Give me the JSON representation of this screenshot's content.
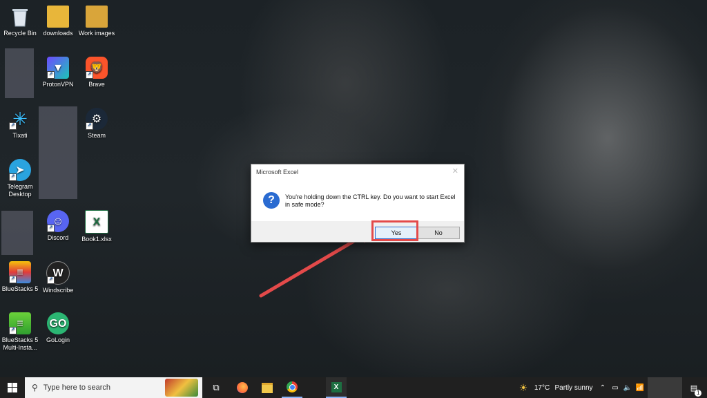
{
  "desktop": {
    "icons": [
      {
        "label": "Recycle Bin",
        "icon": "recycle-bin-icon"
      },
      {
        "label": "downloads",
        "icon": "folder-icon"
      },
      {
        "label": "Work images",
        "icon": "folder-images-icon"
      },
      {
        "label": "ProtonVPN",
        "icon": "protonvpn-icon"
      },
      {
        "label": "Brave",
        "icon": "brave-icon"
      },
      {
        "label": "Tixati",
        "icon": "tixati-icon"
      },
      {
        "label": "Steam",
        "icon": "steam-icon"
      },
      {
        "label": "Telegram Desktop",
        "icon": "telegram-icon"
      },
      {
        "label": "Discord",
        "icon": "discord-icon"
      },
      {
        "label": "Book1.xlsx",
        "icon": "excel-file-icon"
      },
      {
        "label": "BlueStacks 5",
        "icon": "bluestacks-icon"
      },
      {
        "label": "Windscribe",
        "icon": "windscribe-icon"
      },
      {
        "label": "BlueStacks 5 Multi-Insta...",
        "icon": "bluestacks-multi-icon"
      },
      {
        "label": "GoLogin",
        "icon": "gologin-icon"
      }
    ]
  },
  "dialog": {
    "title": "Microsoft Excel",
    "message": "You're holding down the CTRL key. Do you want to start Excel in safe mode?",
    "yes_label": "Yes",
    "no_label": "No"
  },
  "taskbar": {
    "search_placeholder": "Type here to search",
    "weather_temp": "17°C",
    "weather_desc": "Partly sunny",
    "apps": [
      "task-view-icon",
      "firefox-icon",
      "file-explorer-icon",
      "chrome-icon",
      "excel-icon"
    ],
    "notification_count": "1"
  },
  "colors": {
    "highlight": "#e34a4a",
    "taskbar": "#202020",
    "accent": "#2a6bd1"
  }
}
